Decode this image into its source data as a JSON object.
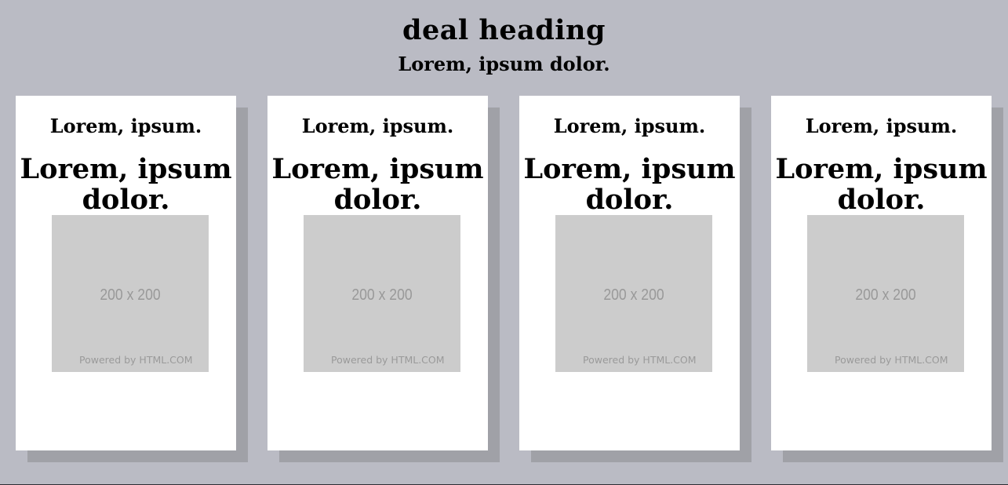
{
  "page": {
    "heading": "deal heading",
    "subheading": "Lorem, ipsum dolor."
  },
  "colors": {
    "background": "#babbc4",
    "card": "#ffffff",
    "card_shadow": "#a0a1a7",
    "placeholder": "#cccccc",
    "placeholder_text": "#999999"
  },
  "cards": [
    {
      "small_title": "Lorem, ipsum.",
      "big_title": "Lorem, ipsum dolor.",
      "image_size_text": "200 x 200",
      "image_powered_text": "Powered by HTML.COM"
    },
    {
      "small_title": "Lorem, ipsum.",
      "big_title": "Lorem, ipsum dolor.",
      "image_size_text": "200 x 200",
      "image_powered_text": "Powered by HTML.COM"
    },
    {
      "small_title": "Lorem, ipsum.",
      "big_title": "Lorem, ipsum dolor.",
      "image_size_text": "200 x 200",
      "image_powered_text": "Powered by HTML.COM"
    },
    {
      "small_title": "Lorem, ipsum.",
      "big_title": "Lorem, ipsum dolor.",
      "image_size_text": "200 x 200",
      "image_powered_text": "Powered by HTML.COM"
    }
  ]
}
